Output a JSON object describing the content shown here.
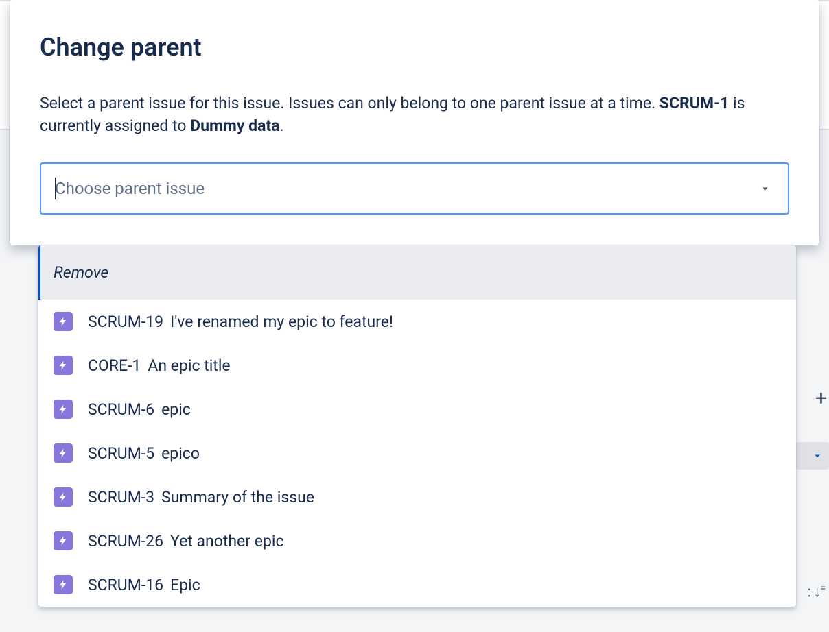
{
  "modal": {
    "title": "Change parent",
    "description_prefix": "Select a parent issue for this issue. Issues can only belong to one parent issue at a time. ",
    "issue_key": "SCRUM-1",
    "description_middle": " is currently assigned to ",
    "current_parent": "Dummy data",
    "description_suffix": ".",
    "placeholder": "Choose parent issue"
  },
  "dropdown": {
    "remove_label": "Remove",
    "options": [
      {
        "key": "SCRUM-19",
        "title": "I've renamed my epic to feature!"
      },
      {
        "key": "CORE-1",
        "title": "An epic title"
      },
      {
        "key": "SCRUM-6",
        "title": "epic"
      },
      {
        "key": "SCRUM-5",
        "title": "epico"
      },
      {
        "key": "SCRUM-3",
        "title": "Summary of the issue"
      },
      {
        "key": "SCRUM-26",
        "title": "Yet another epic"
      },
      {
        "key": "SCRUM-16",
        "title": "Epic"
      }
    ]
  }
}
